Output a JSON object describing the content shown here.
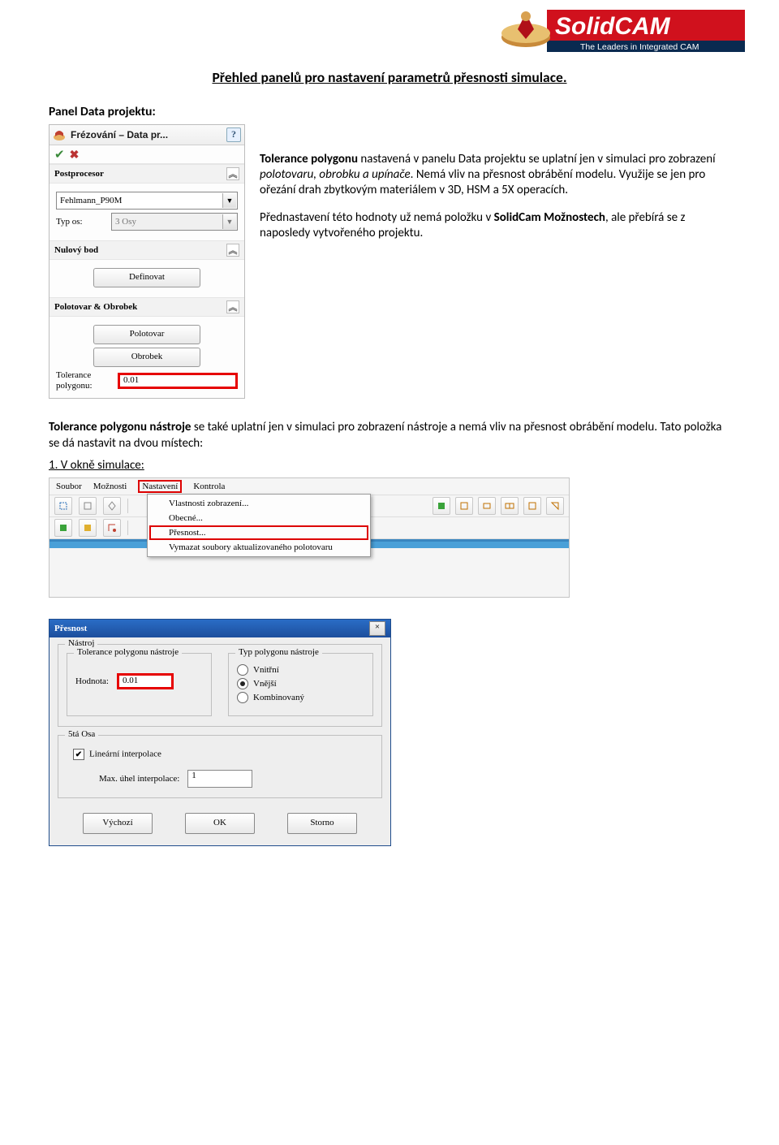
{
  "logo": {
    "brand": "SolidCAM",
    "tagline": "The Leaders in Integrated CAM"
  },
  "title": "Přehled panelů pro nastavení parametrů přesnosti simulace.",
  "subhead": "Panel Data projektu:",
  "para1": {
    "t1a": "Tolerance polygonu",
    "t1b": " nastavená v panelu Data projektu se uplatní jen v simulaci pro zobrazení ",
    "t1c": "polotovaru, obrobku a upínače",
    "t1d": ". Nemá vliv na přesnost obrábění modelu. Využije se jen pro ořezání drah zbytkovým materiálem v 3D, HSM a 5X operacích.",
    "t2a": "Přednastavení této hodnoty už nemá položku v ",
    "t2b": "SolidCam Možnostech",
    "t2c": ", ale přebírá se z naposledy vytvořeného projektu."
  },
  "panel1": {
    "title": "Frézování – Data pr...",
    "help": "?",
    "sections": {
      "post": {
        "head": "Postprocesor",
        "field": "Fehlmann_P90M",
        "axis_label": "Typ os:",
        "axis_val": "3 Osy"
      },
      "zero": {
        "head": "Nulový bod",
        "btn": "Definovat"
      },
      "stock": {
        "head": "Polotovar & Obrobek",
        "btn1": "Polotovar",
        "btn2": "Obrobek",
        "tol_label": "Tolerance polygonu:",
        "tol_val": "0.01"
      }
    }
  },
  "para2": {
    "t1a": "Tolerance polygonu nástroje",
    "t1b": " se také uplatní jen v simulaci pro zobrazení nástroje a nemá vliv na přesnost obrábění modelu. Tato položka se dá nastavit na dvou místech:"
  },
  "numhead": "1.  V okně simulace:",
  "menu": {
    "bar": [
      "Soubor",
      "Možnosti",
      "Nastavení",
      "Kontrola"
    ],
    "drop": [
      "Vlastnosti zobrazení...",
      "Obecné...",
      "Přesnost...",
      "Vymazat soubory aktualizovaného polotovaru"
    ]
  },
  "dlg": {
    "title": "Přesnost",
    "g_tool": "Nástroj",
    "g_tol": "Tolerance polygonu nástroje",
    "val_label": "Hodnota:",
    "val": "0.01",
    "g_type": "Typ polygonu nástroje",
    "radios": [
      "Vnitřní",
      "Vnější",
      "Kombinovaný"
    ],
    "g_5ax": "5tá Osa",
    "lin": "Lineární interpolace",
    "ang_label": "Max. úhel interpolace:",
    "ang_val": "1",
    "btns": [
      "Výchozí",
      "OK",
      "Storno"
    ]
  }
}
